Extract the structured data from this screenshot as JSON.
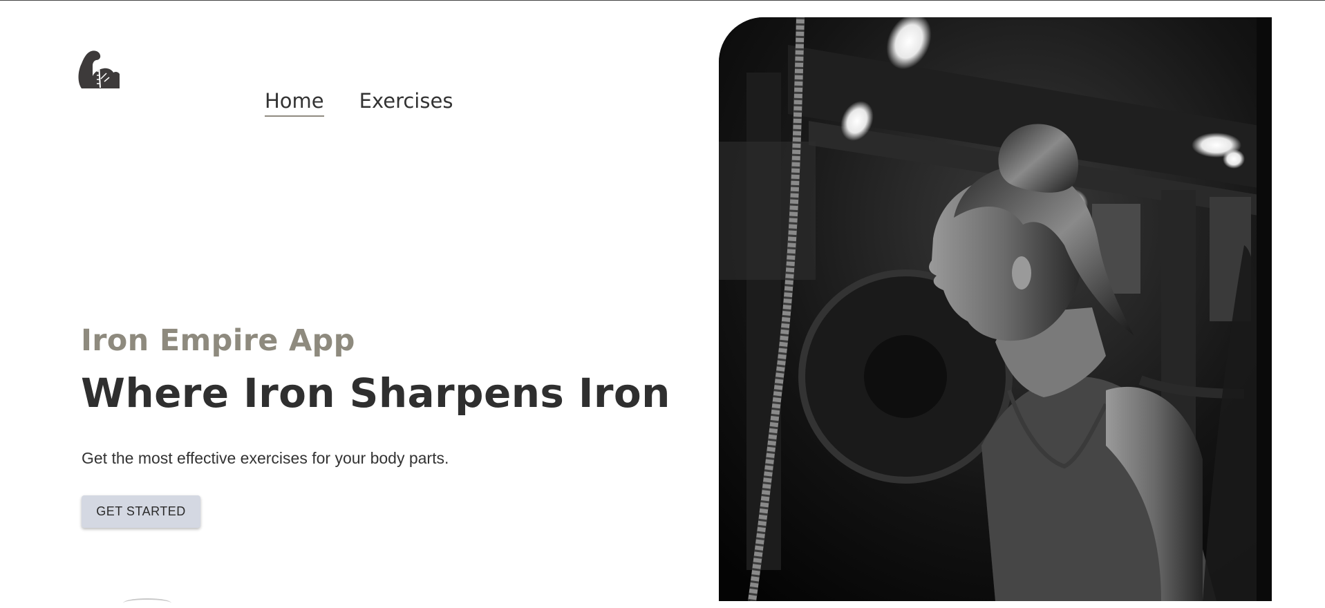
{
  "header": {
    "logo_icon": "flexed-arm-icon",
    "nav": [
      {
        "label": "Home",
        "active": true
      },
      {
        "label": "Exercises",
        "active": false
      }
    ]
  },
  "hero": {
    "subtitle": "Iron Empire App",
    "title": "Where Iron Sharpens Iron",
    "description": "Get the most effective exercises for your body parts.",
    "cta_label": "GET STARTED",
    "cta_color": "#d4d8e2",
    "subtitle_color": "#8e8a7e",
    "title_color": "#2f2f2f"
  }
}
